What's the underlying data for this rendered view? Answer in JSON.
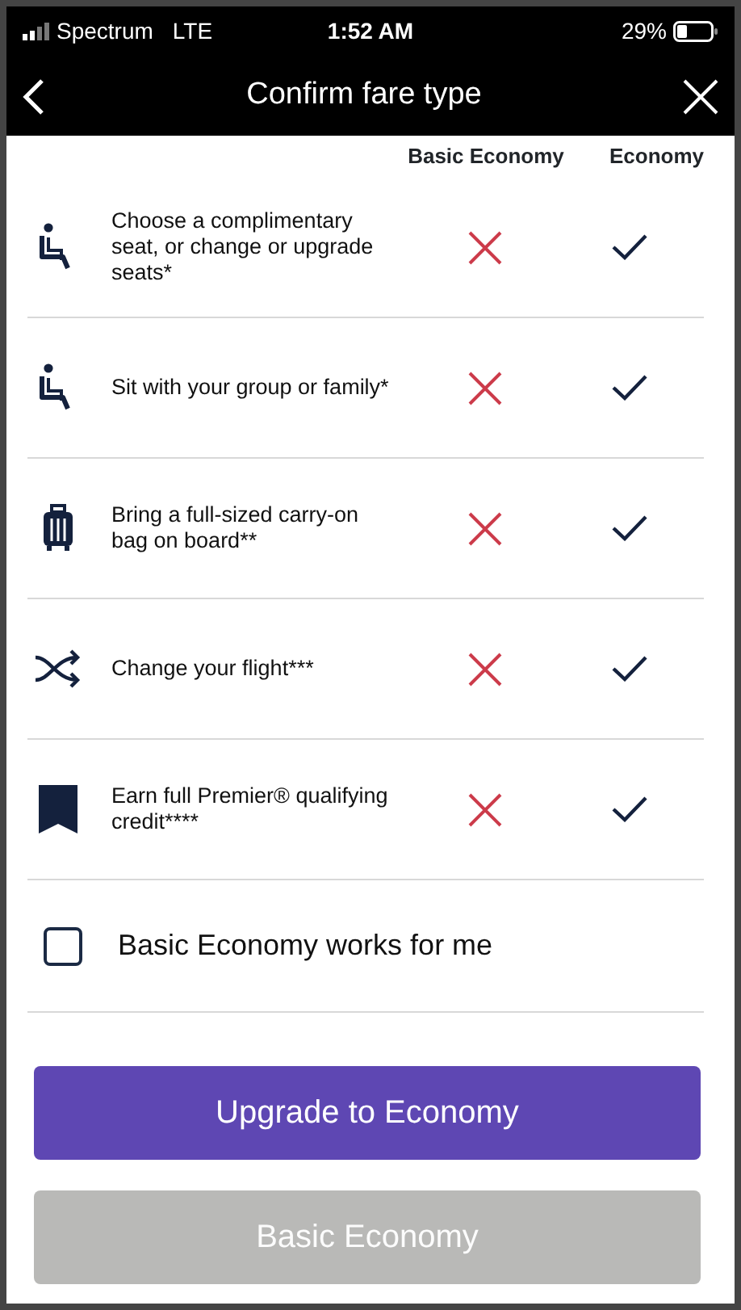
{
  "status_bar": {
    "carrier": "Spectrum",
    "network": "LTE",
    "time": "1:52 AM",
    "battery": "29%"
  },
  "nav": {
    "title": "Confirm fare type"
  },
  "columns": [
    "Basic Economy",
    "Economy"
  ],
  "features": [
    {
      "kind": "seat",
      "text": "Choose a complimentary seat, or change or upgrade seats*",
      "basic": false,
      "economy": true
    },
    {
      "kind": "seat",
      "text": "Sit with your group or family*",
      "basic": false,
      "economy": true
    },
    {
      "kind": "bag",
      "text": "Bring a full-sized carry-on bag on board**",
      "basic": false,
      "economy": true
    },
    {
      "kind": "change",
      "text": "Change your flight***",
      "basic": false,
      "economy": true
    },
    {
      "kind": "credit",
      "text": "Earn full Premier® qualifying credit****",
      "basic": false,
      "economy": true
    }
  ],
  "agree": {
    "label": "Basic Economy works for me",
    "checked": false
  },
  "buttons": [
    {
      "label": "Upgrade to Economy",
      "disabled": false
    },
    {
      "label": "Basic Economy",
      "disabled": true
    }
  ]
}
